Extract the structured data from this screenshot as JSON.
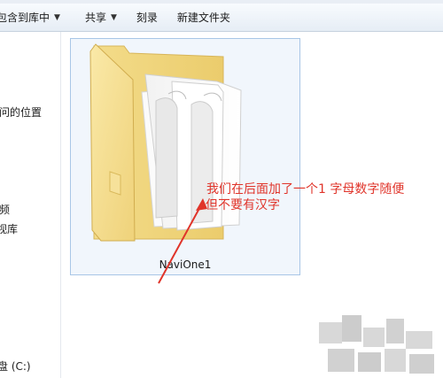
{
  "toolbar": {
    "items": [
      {
        "label": "包含到库中",
        "has_menu": true
      },
      {
        "label": "共享",
        "has_menu": true
      },
      {
        "label": "刻录",
        "has_menu": false
      },
      {
        "label": "新建文件夹",
        "has_menu": false
      }
    ]
  },
  "nav": {
    "items": [
      {
        "label": "问的位置"
      },
      {
        "label": "频"
      },
      {
        "label": "视库"
      },
      {
        "label": "盘 (C:)"
      }
    ]
  },
  "folder": {
    "name": "NaviOne1",
    "selected": true
  },
  "annotation": {
    "line1": "我们在后面加了一个1 字母数字随便",
    "line2": "但不要有汉字",
    "color": "#e0342a"
  },
  "icons": {
    "dropdown": "caret-down-icon",
    "folder": "folder-icon"
  },
  "colors": {
    "selection_border": "#a8c6e6",
    "selection_fill": "#f1f6fc",
    "annotation": "#e0342a"
  }
}
